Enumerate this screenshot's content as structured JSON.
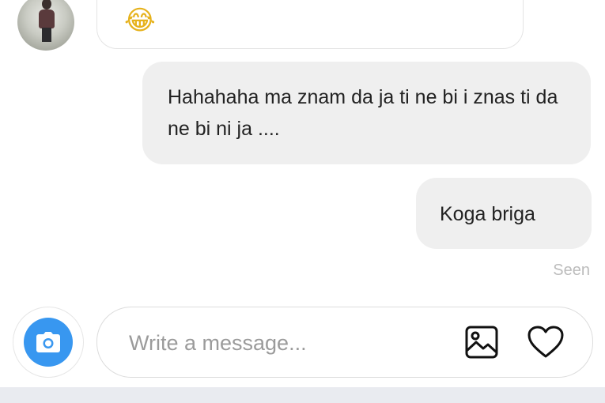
{
  "conversation": {
    "incoming": [
      {
        "emoji": "😂"
      }
    ],
    "outgoing": [
      {
        "text": "Hahahaha ma znam da ja ti ne bi i znas ti da ne bi ni ja ...."
      },
      {
        "text": "Koga briga"
      }
    ],
    "status": "Seen"
  },
  "composer": {
    "placeholder": "Write a message...",
    "camera_icon": "camera-icon",
    "gallery_icon": "image-icon",
    "like_icon": "heart-icon"
  },
  "colors": {
    "accent": "#3897f0",
    "outgoing_bubble": "#efefef",
    "status_text": "#bcbcbc"
  }
}
